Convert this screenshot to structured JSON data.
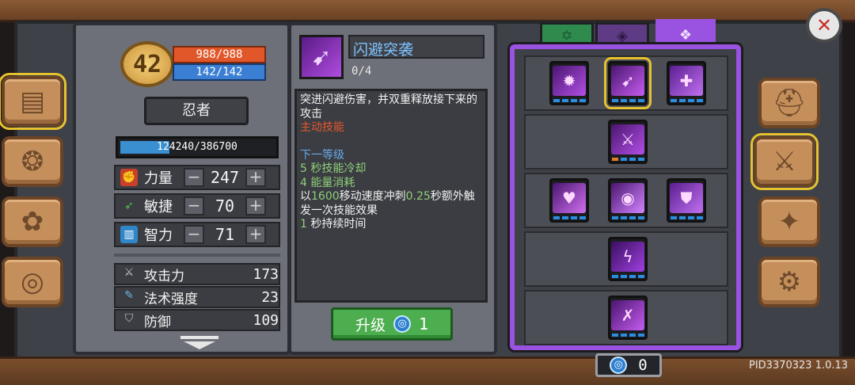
{
  "hero": {
    "level": "42",
    "hp": "988/988",
    "mp": "142/142",
    "class_name": "忍者",
    "xp_text": "124240/386700",
    "xp_fraction": 0.32
  },
  "attributes": [
    {
      "label": "力量",
      "value": "247",
      "icon": "fist-icon",
      "minus": "−",
      "plus": "+"
    },
    {
      "label": "敏捷",
      "value": "70",
      "icon": "feather-icon",
      "minus": "−",
      "plus": "+"
    },
    {
      "label": "智力",
      "value": "71",
      "icon": "book-icon",
      "minus": "−",
      "plus": "+"
    }
  ],
  "stats": [
    {
      "label": "攻击力",
      "value": "173",
      "icon": "sword-icon"
    },
    {
      "label": "法术强度",
      "value": "23",
      "icon": "wand-icon"
    },
    {
      "label": "防御",
      "value": "109",
      "icon": "shield-icon"
    }
  ],
  "skill": {
    "title": "闪避突袭",
    "rank": "0/4",
    "desc_line1": "突进闪避伤害，并双重释放接下来的攻击",
    "type": "主动技能",
    "next_level": "下一等级",
    "cooldown_num": "5",
    "cooldown_text": " 秒技能冷却",
    "energy_num": "4",
    "energy_text": " 能量消耗",
    "effect_pre": "以",
    "effect_speed": "1600",
    "effect_mid": "移动速度冲刺",
    "effect_time": "0.25",
    "effect_post": "秒额外触发一次技能效果",
    "duration_num": "1",
    "duration_text": " 秒持续时间"
  },
  "upgrade": {
    "label": "升级",
    "cost": "1"
  },
  "skill_points": "0",
  "pid": "PID3370323 1.0.13",
  "colors": {
    "accent_purple": "#9a52e0",
    "hp": "#e2572a",
    "mp": "#3b7fd4",
    "upgrade": "#4cae4e",
    "skill_title": "#7ec3ff"
  }
}
